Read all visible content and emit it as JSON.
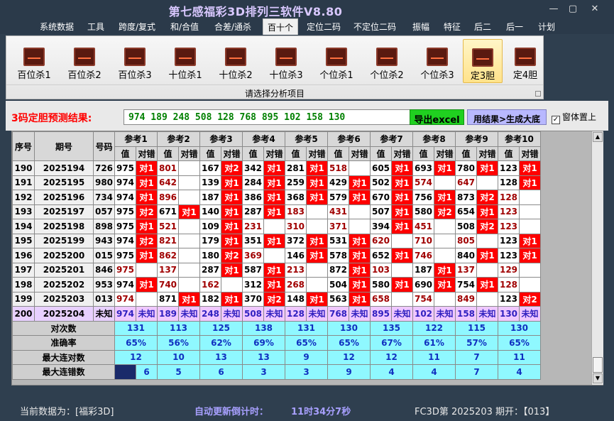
{
  "window": {
    "title": "第七感福彩3D排列三软件V8.80",
    "minimize": "—",
    "restore": "▢",
    "close": "✕"
  },
  "menu": [
    "系统数据",
    "工具",
    "跨度/复式",
    "和/合值",
    "合差/通杀",
    "百十个",
    "定位二码",
    "不定位二码",
    "振幅",
    "特征",
    "后二",
    "后一",
    "计划"
  ],
  "menu_active_index": 5,
  "ribbon": {
    "buttons": [
      "百位杀1",
      "百位杀2",
      "百位杀3",
      "十位杀1",
      "十位杀2",
      "十位杀3",
      "个位杀1",
      "个位杀2",
      "个位杀3",
      "定3胆",
      "定4胆"
    ],
    "active_index": 9,
    "footer": "请选择分析项目"
  },
  "result": {
    "label": "3码定胆预测结果:",
    "value": "974 189 248 508 128 768 895 102 158 130",
    "export_button": "导出excel",
    "generate_button": "用结果>生成大底",
    "topmost_label": "窗体置上",
    "topmost_checked": "✓"
  },
  "grid": {
    "lead_headers": [
      "序号",
      "期号",
      "号码"
    ],
    "ref_headers": [
      "参考1",
      "参考2",
      "参考3",
      "参考4",
      "参考5",
      "参考6",
      "参考7",
      "参考8",
      "参考9",
      "参考10"
    ],
    "sub_headers": [
      "值",
      "对错"
    ],
    "hit_labels": {
      "1": "对1",
      "2": "对2"
    },
    "rows": [
      {
        "no": "190",
        "issue": "2025194",
        "num": "726",
        "cells": [
          [
            "975",
            "1"
          ],
          [
            "801",
            ""
          ],
          [
            "167",
            "2"
          ],
          [
            "342",
            "1"
          ],
          [
            "281",
            "1"
          ],
          [
            "518",
            ""
          ],
          [
            "605",
            "1"
          ],
          [
            "693",
            "1"
          ],
          [
            "780",
            "1"
          ],
          [
            "123",
            "1"
          ]
        ]
      },
      {
        "no": "191",
        "issue": "2025195",
        "num": "980",
        "cells": [
          [
            "974",
            "1"
          ],
          [
            "642",
            ""
          ],
          [
            "139",
            "1"
          ],
          [
            "284",
            "1"
          ],
          [
            "259",
            "1"
          ],
          [
            "429",
            "1"
          ],
          [
            "502",
            "1"
          ],
          [
            "574",
            ""
          ],
          [
            "647",
            ""
          ],
          [
            "128",
            "1"
          ]
        ]
      },
      {
        "no": "192",
        "issue": "2025196",
        "num": "734",
        "cells": [
          [
            "974",
            "1"
          ],
          [
            "896",
            ""
          ],
          [
            "187",
            "1"
          ],
          [
            "386",
            "1"
          ],
          [
            "368",
            "1"
          ],
          [
            "579",
            "1"
          ],
          [
            "670",
            "1"
          ],
          [
            "756",
            "1"
          ],
          [
            "873",
            "2"
          ],
          [
            "128",
            ""
          ]
        ]
      },
      {
        "no": "193",
        "issue": "2025197",
        "num": "057",
        "cells": [
          [
            "975",
            "2"
          ],
          [
            "671",
            "1"
          ],
          [
            "140",
            "1"
          ],
          [
            "287",
            "1"
          ],
          [
            "183",
            ""
          ],
          [
            "431",
            ""
          ],
          [
            "507",
            "1"
          ],
          [
            "580",
            "2"
          ],
          [
            "654",
            "1"
          ],
          [
            "123",
            ""
          ]
        ]
      },
      {
        "no": "194",
        "issue": "2025198",
        "num": "898",
        "cells": [
          [
            "975",
            "1"
          ],
          [
            "521",
            ""
          ],
          [
            "109",
            "1"
          ],
          [
            "231",
            ""
          ],
          [
            "310",
            ""
          ],
          [
            "371",
            ""
          ],
          [
            "394",
            "1"
          ],
          [
            "451",
            ""
          ],
          [
            "508",
            "2"
          ],
          [
            "123",
            ""
          ]
        ]
      },
      {
        "no": "195",
        "issue": "2025199",
        "num": "943",
        "cells": [
          [
            "974",
            "2"
          ],
          [
            "821",
            ""
          ],
          [
            "179",
            "1"
          ],
          [
            "351",
            "1"
          ],
          [
            "372",
            "1"
          ],
          [
            "531",
            "1"
          ],
          [
            "620",
            ""
          ],
          [
            "710",
            ""
          ],
          [
            "805",
            ""
          ],
          [
            "123",
            "1"
          ]
        ]
      },
      {
        "no": "196",
        "issue": "2025200",
        "num": "015",
        "cells": [
          [
            "975",
            "1"
          ],
          [
            "862",
            ""
          ],
          [
            "180",
            "2"
          ],
          [
            "369",
            ""
          ],
          [
            "146",
            "1"
          ],
          [
            "578",
            "1"
          ],
          [
            "652",
            "1"
          ],
          [
            "746",
            ""
          ],
          [
            "840",
            "1"
          ],
          [
            "123",
            "1"
          ]
        ]
      },
      {
        "no": "197",
        "issue": "2025201",
        "num": "846",
        "cells": [
          [
            "975",
            ""
          ],
          [
            "137",
            ""
          ],
          [
            "287",
            "1"
          ],
          [
            "587",
            "1"
          ],
          [
            "213",
            ""
          ],
          [
            "872",
            "1"
          ],
          [
            "103",
            ""
          ],
          [
            "187",
            "1"
          ],
          [
            "137",
            ""
          ],
          [
            "129",
            ""
          ]
        ]
      },
      {
        "no": "198",
        "issue": "2025202",
        "num": "953",
        "cells": [
          [
            "974",
            "1"
          ],
          [
            "740",
            ""
          ],
          [
            "162",
            ""
          ],
          [
            "312",
            "1"
          ],
          [
            "268",
            ""
          ],
          [
            "504",
            "1"
          ],
          [
            "580",
            "1"
          ],
          [
            "690",
            "1"
          ],
          [
            "754",
            "1"
          ],
          [
            "128",
            ""
          ]
        ]
      },
      {
        "no": "199",
        "issue": "2025203",
        "num": "013",
        "cells": [
          [
            "974",
            ""
          ],
          [
            "871",
            "1"
          ],
          [
            "182",
            "1"
          ],
          [
            "370",
            "2"
          ],
          [
            "148",
            "1"
          ],
          [
            "563",
            "1"
          ],
          [
            "658",
            ""
          ],
          [
            "754",
            ""
          ],
          [
            "849",
            ""
          ],
          [
            "123",
            "2"
          ]
        ]
      }
    ],
    "predict_row": {
      "no": "200",
      "issue": "2025204",
      "num": "未知",
      "values": [
        "974",
        "189",
        "248",
        "508",
        "128",
        "768",
        "895",
        "102",
        "158",
        "130"
      ],
      "status": "未知"
    },
    "stats": [
      {
        "label": "对次数",
        "values": [
          "131",
          "113",
          "125",
          "138",
          "131",
          "130",
          "135",
          "122",
          "115",
          "130"
        ]
      },
      {
        "label": "准确率",
        "values": [
          "65%",
          "56%",
          "62%",
          "69%",
          "65%",
          "65%",
          "67%",
          "61%",
          "57%",
          "65%"
        ]
      },
      {
        "label": "最大连对数",
        "values": [
          "12",
          "10",
          "13",
          "13",
          "9",
          "12",
          "12",
          "11",
          "7",
          "11"
        ]
      },
      {
        "label": "最大连错数",
        "values": [
          "6",
          "5",
          "6",
          "3",
          "3",
          "9",
          "4",
          "4",
          "7",
          "4"
        ]
      }
    ]
  },
  "status": {
    "current_data": "当前数据为：[福彩3D]",
    "countdown_label": "自动更新倒计时：",
    "countdown_value": "11时34分7秒",
    "draw_info": "FC3D第 2025203 期开：【013】"
  },
  "colors": {
    "hit": "#ff0000",
    "stat_bg": "#8ff8ff",
    "predict_bg": "#f0c8ff",
    "export_btn": "#20d020",
    "gen_btn": "#b8b8ff"
  }
}
